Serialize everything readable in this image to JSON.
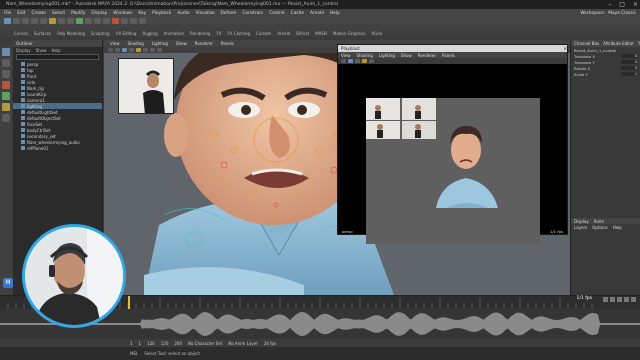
{
  "window": {
    "title": "Nam_Wheelarmying001.mb* - Autodesk MAYA 2024.2: D:\\Docs\\Animation\\Proj\\scenes\\Talking\\Nam_Wheelarmying001.ma --- Resist_Anim_1_control"
  },
  "menubar": {
    "items": [
      "File",
      "Edit",
      "Create",
      "Select",
      "Modify",
      "Display",
      "Windows",
      "Key",
      "Playback",
      "Audio",
      "Visualize",
      "Deform",
      "Constrain",
      "Control",
      "Cache",
      "Arnold",
      "Help"
    ],
    "workspace_label": "Workspace:",
    "workspace_value": "Maya Classic"
  },
  "shelf_tabs": [
    "Curves",
    "Surfaces",
    "Poly Modeling",
    "Sculpting",
    "UV Editing",
    "Rigging",
    "Animation",
    "Rendering",
    "FX",
    "FX Caching",
    "Custom",
    "Arnold",
    "Bifrost",
    "MASH",
    "Motion Graphics",
    "XGen"
  ],
  "outliner": {
    "title": "Outliner",
    "menu": [
      "Display",
      "Show",
      "Help"
    ],
    "items": [
      {
        "label": "persp",
        "selected": false
      },
      {
        "label": "top",
        "selected": false
      },
      {
        "label": "front",
        "selected": false
      },
      {
        "label": "side",
        "selected": false
      },
      {
        "label": "Nam_rig",
        "selected": false
      },
      {
        "label": "soundGrp",
        "selected": false
      },
      {
        "label": "camera1",
        "selected": false
      },
      {
        "label": "lighting",
        "selected": true
      },
      {
        "label": "defaultLightSet",
        "selected": false
      },
      {
        "label": "defaultObjectSet",
        "selected": false
      },
      {
        "label": "faceSet",
        "selected": false
      },
      {
        "label": "bodyCtrlSet",
        "selected": false
      },
      {
        "label": "secondary_set",
        "selected": false
      },
      {
        "label": "Nam_wheelarmying_audio",
        "selected": false
      },
      {
        "label": "refPlane01",
        "selected": false
      }
    ]
  },
  "viewport": {
    "menu": [
      "View",
      "Shading",
      "Lighting",
      "Show",
      "Renderer",
      "Panels"
    ]
  },
  "render_window": {
    "title": "Playblast",
    "menu": [
      "View",
      "Shading",
      "Lighting",
      "Show",
      "Renderer",
      "Panels"
    ],
    "status_left": "persp",
    "status_right": "1/1 fps"
  },
  "right_panel": {
    "tabs": [
      "Channel Box",
      "Attribute Editor",
      "Tool Settings"
    ],
    "object_name": "Resist_Anim_1_control",
    "channels": [
      {
        "name": "Translate X",
        "value": "0"
      },
      {
        "name": "Translate Y",
        "value": "0"
      },
      {
        "name": "Rotate Z",
        "value": "0"
      },
      {
        "name": "Scale Y",
        "value": "1"
      }
    ],
    "layer_tabs": [
      "Display",
      "Anim"
    ],
    "layer_menu": [
      "Layers",
      "Options",
      "Help"
    ]
  },
  "timeline": {
    "current_frame": "1/1 fps"
  },
  "range_bar": {
    "items": [
      "1",
      "1",
      "120",
      "120",
      "200",
      "No Character Set",
      "No Anim Layer",
      "24 fps"
    ]
  },
  "command_line": {
    "label": "MEL",
    "hint": "Select Tool: select an object"
  },
  "logo": {
    "letter": "M"
  },
  "colors": {
    "accent_blue": "#2ea8e6",
    "selection": "#4a6d8c",
    "viewport_bg": "#5c6268",
    "scene_bg": "#5e5e5e"
  }
}
